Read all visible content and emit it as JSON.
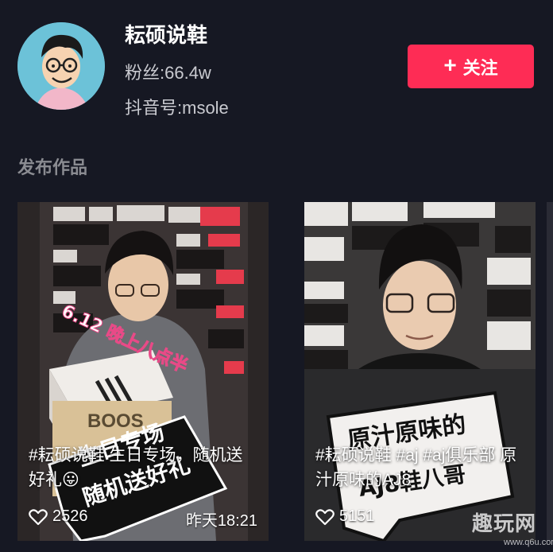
{
  "profile": {
    "name": "耘硕说鞋",
    "fans": "粉丝:66.4w",
    "douyin_id": "抖音号:msole",
    "follow_label": "关注",
    "follow_icon": "plus-icon"
  },
  "section_title": "发布作品",
  "videos": [
    {
      "caption": "#耘硕说鞋 生日专场，随机送好礼😛",
      "likes": "2526",
      "time": "昨天18:21",
      "overlay_text_1": "6.12 晚上八点半",
      "overlay_text_2": "生日专场",
      "overlay_text_3": "随机送好礼",
      "box_text": "BOOS"
    },
    {
      "caption": "#耘硕说鞋 #aj #aj俱乐部 原汁原味的AJ8",
      "likes": "5151",
      "time": "",
      "overlay_text_1": "原汁原味的",
      "overlay_text_2": "AJ8鞋八哥"
    }
  ],
  "watermark": {
    "main": "趣玩网",
    "sub": "www.q6u.com"
  },
  "colors": {
    "background": "#161823",
    "accent": "#fe2c55",
    "secondary_text": "#c9cad0",
    "section_title": "#8a8b91"
  }
}
